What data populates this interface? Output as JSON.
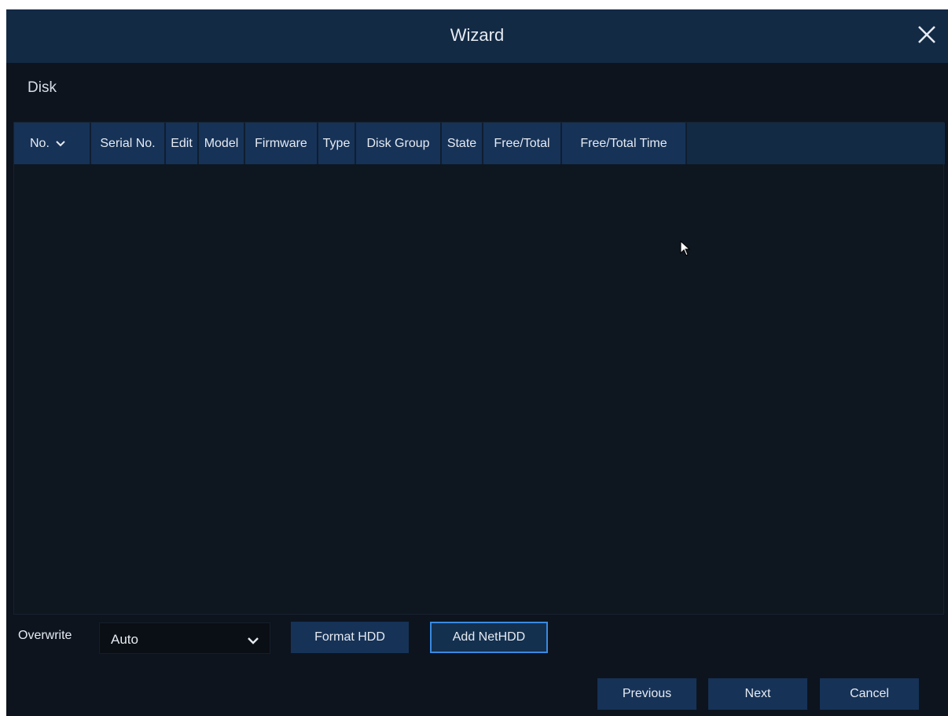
{
  "window": {
    "title": "Wizard",
    "close_icon": "close-icon"
  },
  "section": {
    "label": "Disk"
  },
  "table": {
    "columns": [
      {
        "label": "No.",
        "sortable": true,
        "sort_icon": "chevron-down-icon"
      },
      {
        "label": "Serial No."
      },
      {
        "label": "Edit"
      },
      {
        "label": "Model"
      },
      {
        "label": "Firmware"
      },
      {
        "label": "Type"
      },
      {
        "label": "Disk Group"
      },
      {
        "label": "State"
      },
      {
        "label": "Free/Total"
      },
      {
        "label": "Free/Total Time"
      }
    ],
    "rows": []
  },
  "controls": {
    "overwrite_label": "Overwrite",
    "overwrite_value": "Auto",
    "format_hdd_label": "Format HDD",
    "add_nethdd_label": "Add NetHDD"
  },
  "footer": {
    "previous_label": "Previous",
    "next_label": "Next",
    "cancel_label": "Cancel"
  },
  "colors": {
    "background": "#0d141e",
    "header": "#132a45",
    "button": "#163257",
    "focus_border": "#3a8ae0",
    "text": "#e6ebf2"
  }
}
